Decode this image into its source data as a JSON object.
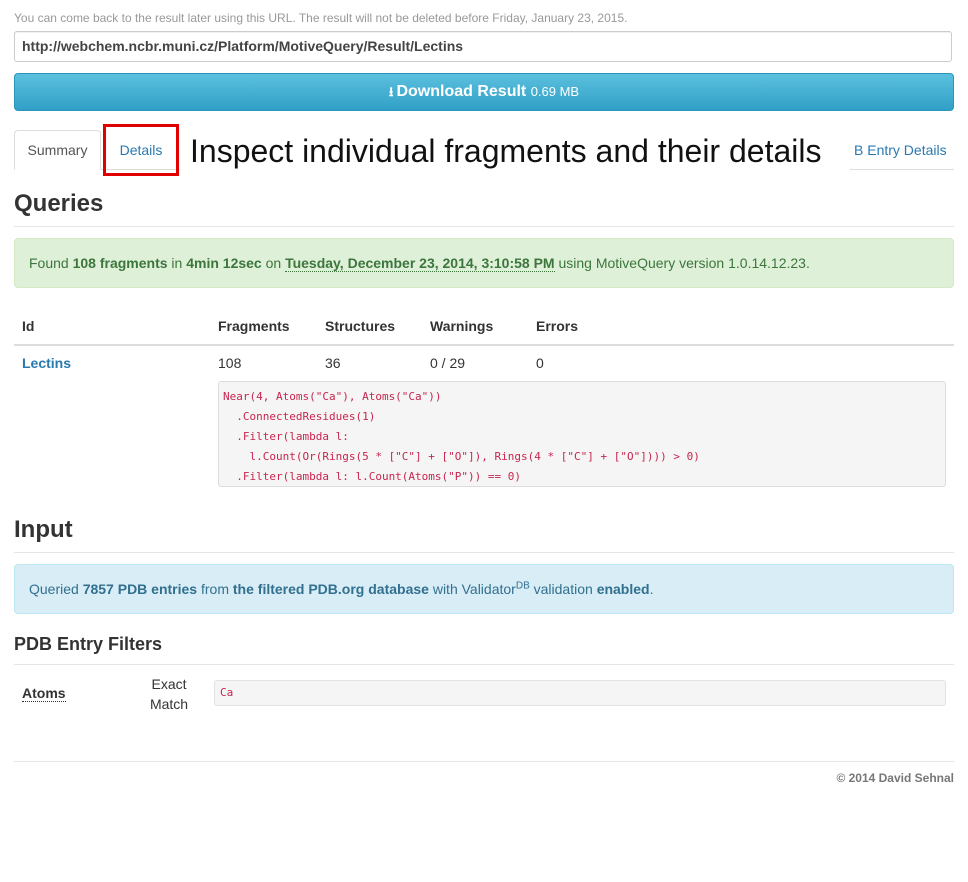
{
  "notice": "You can come back to the result later using this URL. The result will not be deleted before Friday, January 23, 2015.",
  "url": "http://webchem.ncbr.muni.cz/Platform/MotiveQuery/Result/Lectins",
  "download": {
    "label": "Download Result",
    "size": "0.69 MB",
    "icon": "download-icon"
  },
  "tabs": [
    {
      "label": "Summary",
      "active": true
    },
    {
      "label": "Details",
      "active": false
    },
    {
      "label": "B Entry Details",
      "active": false
    }
  ],
  "callout": "Inspect individual fragments and their details",
  "queries": {
    "heading": "Queries",
    "found": {
      "prefix": "Found",
      "count": "108 fragments",
      "in": "in",
      "time": "4min 12sec",
      "on": "on",
      "date": "Tuesday, December 23, 2014, 3:10:58 PM",
      "suffix": "using MotiveQuery version 1.0.14.12.23."
    },
    "columns": [
      "Id",
      "Fragments",
      "Structures",
      "Warnings",
      "Errors"
    ],
    "rows": [
      {
        "id": "Lectins",
        "fragments": "108",
        "structures": "36",
        "warnings": "0 / 29",
        "errors": "0"
      }
    ],
    "code": [
      "Near(4, Atoms(\"Ca\"), Atoms(\"Ca\"))",
      "  .ConnectedResidues(1)",
      "  .Filter(lambda l:",
      "    l.Count(Or(Rings(5 * [\"C\"] + [\"O\"]), Rings(4 * [\"C\"] + [\"O\"]))) > 0)",
      "  .Filter(lambda l: l.Count(Atoms(\"P\")) == 0)"
    ]
  },
  "input": {
    "heading": "Input",
    "queried": "Queried",
    "count": "7857 PDB entries",
    "from": "from",
    "source": "the filtered PDB.org database",
    "with": "with Validator",
    "sup": "DB",
    "validation": "validation",
    "enabled": "enabled",
    "end": "."
  },
  "filters": {
    "heading": "PDB Entry Filters",
    "label": "Atoms",
    "mode_line1": "Exact",
    "mode_line2": "Match",
    "value": "Ca"
  },
  "footer": "© 2014 David Sehnal"
}
